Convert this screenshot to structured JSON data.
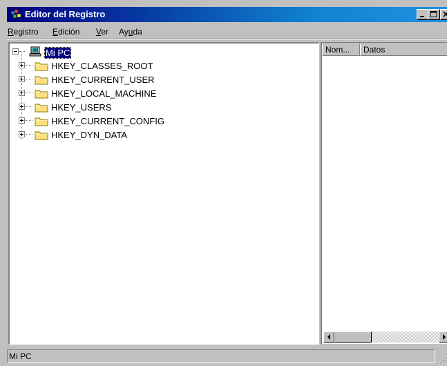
{
  "window": {
    "title": "Editor del Registro"
  },
  "menu": [
    {
      "underline": "R",
      "rest": "egistro"
    },
    {
      "underline": "E",
      "rest": "dición"
    },
    {
      "underline": "V",
      "rest": "er"
    },
    {
      "pre": "Ay",
      "underline": "u",
      "rest": "da"
    }
  ],
  "tree": {
    "root": "Mi PC",
    "keys": [
      "HKEY_CLASSES_ROOT",
      "HKEY_CURRENT_USER",
      "HKEY_LOCAL_MACHINE",
      "HKEY_USERS",
      "HKEY_CURRENT_CONFIG",
      "HKEY_DYN_DATA"
    ]
  },
  "list": {
    "col_name": "Nom...",
    "col_data": "Datos"
  },
  "status": {
    "text": "Mi PC"
  }
}
